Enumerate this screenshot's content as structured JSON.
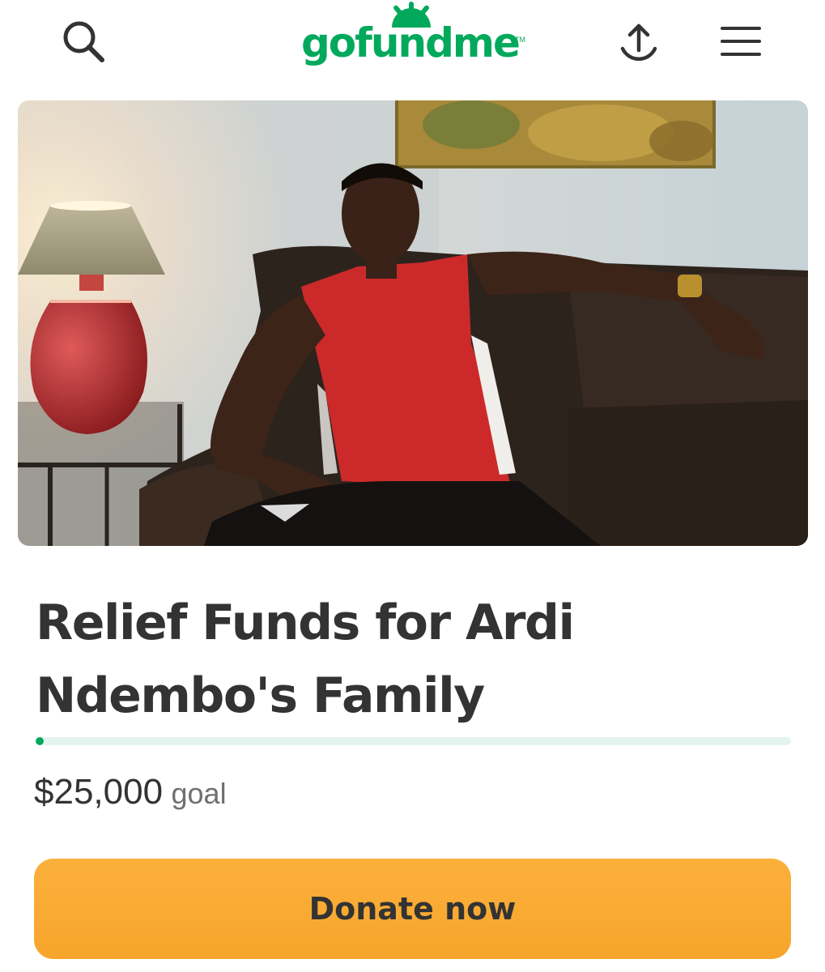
{
  "header": {
    "logo_text": "gofundme",
    "logo_tm": "TM",
    "brand_color": "#02a95c",
    "icons": [
      "search-icon",
      "share-icon",
      "menu-icon"
    ]
  },
  "hero": {
    "description": "campaign-photo"
  },
  "campaign": {
    "title": "Relief Funds for Ardi Ndembo's Family",
    "goal_amount": "$25,000",
    "goal_label": "goal",
    "progress_fraction": 0.01
  },
  "actions": {
    "donate_label": "Donate now",
    "donate_color": "#fbb03b"
  }
}
